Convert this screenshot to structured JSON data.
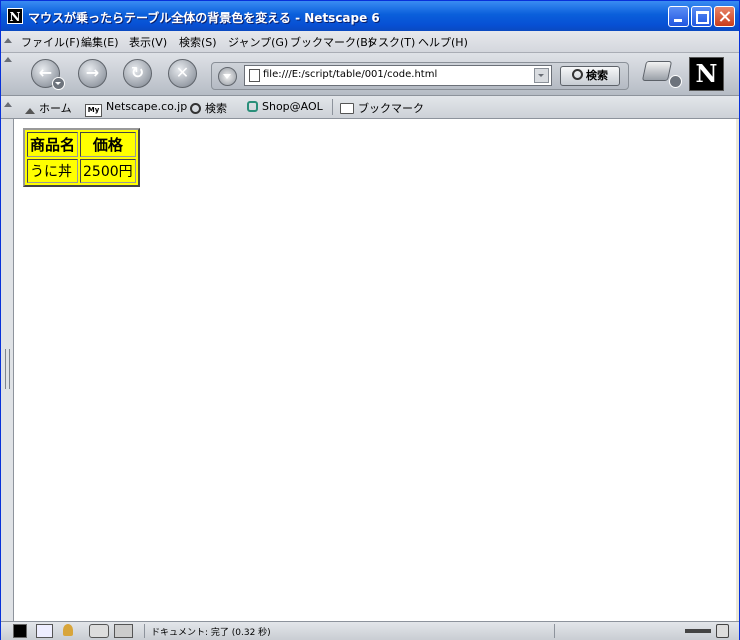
{
  "window": {
    "title": "マウスが乗ったらテーブル全体の背景色を変える - Netscape 6",
    "app_icon": "N"
  },
  "menubar": {
    "items": [
      "ファイル(F)",
      "編集(E)",
      "表示(V)",
      "検索(S)",
      "ジャンプ(G)",
      "ブックマーク(B)",
      "タスク(T)",
      "ヘルプ(H)"
    ]
  },
  "navbar": {
    "url": "file:///E:/script/table/001/code.html",
    "search_label": "検索",
    "throbber_letter": "N"
  },
  "personal_toolbar": {
    "items": [
      "ホーム",
      "Netscape.co.jp",
      "検索",
      "Shop@AOL",
      "ブックマーク"
    ],
    "my_badge": "My"
  },
  "page": {
    "table": {
      "background": "#ffff00",
      "headers": [
        "商品名",
        "価格"
      ],
      "rows": [
        [
          "うに丼",
          "2500円"
        ]
      ]
    }
  },
  "status": {
    "text": "ドキュメント: 完了 (0.32 秒)"
  },
  "colors": {
    "titlebar": "#0a5fdb",
    "table_bg": "#ffff00"
  }
}
